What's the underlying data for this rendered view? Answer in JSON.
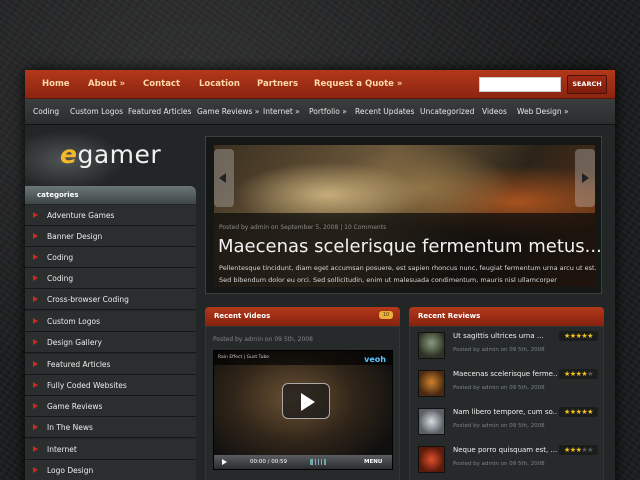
{
  "top_nav": {
    "items": [
      "Home",
      "About »",
      "Contact",
      "Location",
      "Partners",
      "Request a Quote »"
    ],
    "search_button": "SEARCH",
    "search_value": ""
  },
  "sub_nav": {
    "items": [
      "Coding",
      "Custom Logos",
      "Featured Articles",
      "Game Reviews »",
      "Internet »",
      "Portfolio »",
      "Recent Updates",
      "Uncategorized",
      "Videos",
      "Web Design »"
    ]
  },
  "logo": {
    "e": "e",
    "rest": "gamer"
  },
  "categories": {
    "heading": "categories",
    "items": [
      "Adventure Games",
      "Banner Design",
      "Coding",
      "Coding",
      "Cross-browser Coding",
      "Custom Logos",
      "Design Gallery",
      "Featured Articles",
      "Fully Coded Websites",
      "Game Reviews",
      "In The News",
      "Internet",
      "Logo Design"
    ]
  },
  "slider": {
    "meta": "Posted by admin on September 5, 2008 | 10 Comments",
    "title": "Maecenas scelerisque fermentum metus...",
    "excerpt": "Pellentesque tincidunt, diam eget accumsan posuere, est sapien rhoncus nunc, feugiat fermentum urna arcu ut est. Sed bibendum dolor eu orci. Sed sollicitudin, enim ut malesuada condimentum, mauris nisl ullamcorper"
  },
  "recent_videos": {
    "heading": "Recent Videos",
    "badge": "10",
    "meta": "Posted by admin on 09 5th, 2008",
    "player_title": "Rain Effect | Gust Tube",
    "player_logo": "veoh",
    "time": "00:00 / 00:59",
    "menu": "MENU"
  },
  "recent_reviews": {
    "heading": "Recent Reviews",
    "items": [
      {
        "title": "Ut sagittis ultrices urna ...",
        "meta": "Posted by admin on 09 5th, 2008",
        "rating": 5
      },
      {
        "title": "Maecenas scelerisque ferme...",
        "meta": "Posted by admin on 09 5th, 2008",
        "rating": 4
      },
      {
        "title": "Nam libero tempore, cum so...",
        "meta": "Posted by admin on 09 5th, 2008",
        "rating": 5
      },
      {
        "title": "Neque porro quisquam est, ...",
        "meta": "Posted by admin on 09 5th, 2008",
        "rating": 3
      }
    ]
  },
  "colors": {
    "accent_red": "#b3381a",
    "star_gold": "#f3c21e",
    "logo_e": "#f5b72a"
  }
}
